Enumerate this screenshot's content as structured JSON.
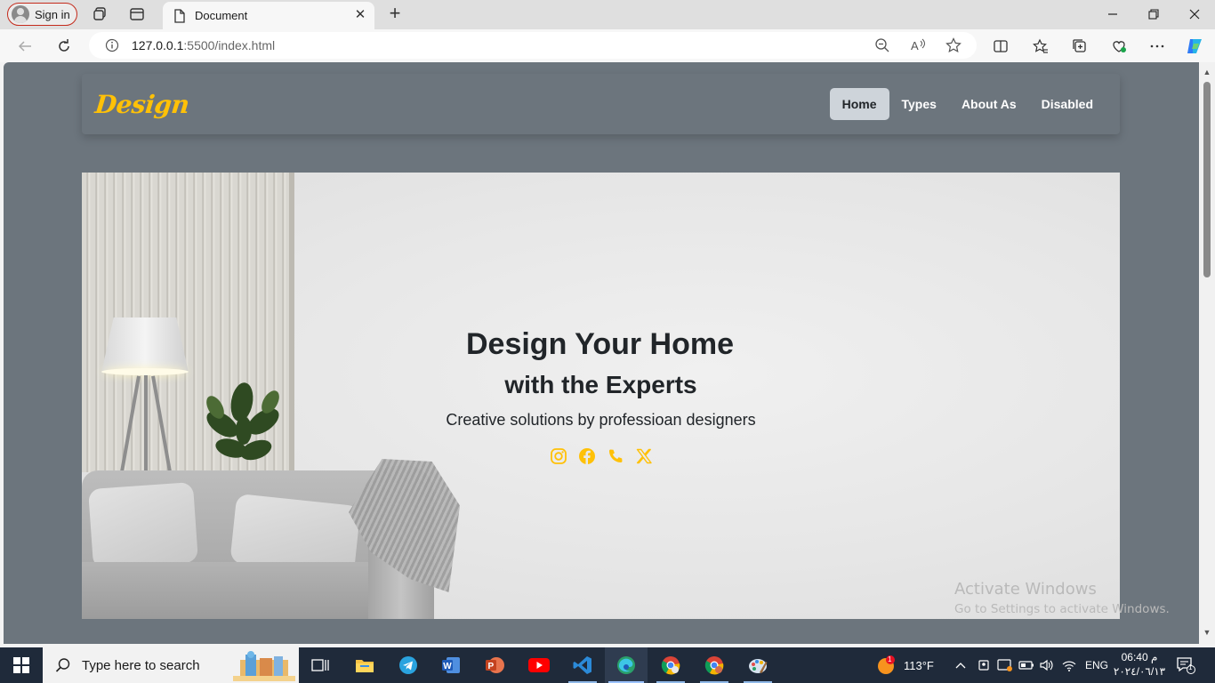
{
  "browser": {
    "profile_label": "Sign in",
    "tab_title": "Document",
    "url_host": "127.0.0.1",
    "url_path": ":5500/index.html"
  },
  "site": {
    "brand": "Design",
    "nav": [
      {
        "label": "Home",
        "active": true
      },
      {
        "label": "Types",
        "active": false
      },
      {
        "label": "About As",
        "active": false
      },
      {
        "label": "Disabled",
        "active": false
      }
    ],
    "hero": {
      "title": "Design Your Home",
      "subtitle": "with the Experts",
      "description": "Creative solutions by professioan designers",
      "social_icons": [
        "instagram-icon",
        "facebook-icon",
        "phone-icon",
        "x-twitter-icon"
      ]
    },
    "colors": {
      "accent": "#ffc107",
      "background": "#6c757d",
      "active_link_bg": "#ced4da"
    }
  },
  "watermark": {
    "title": "Activate Windows",
    "subtitle": "Go to Settings to activate Windows."
  },
  "taskbar": {
    "search_placeholder": "Type here to search",
    "weather": "113°F",
    "language": "ENG",
    "time": "06:40 م",
    "date": "٢٠٢٤/٠٦/١٣",
    "weather_badge": "1",
    "notification_count": "1"
  }
}
